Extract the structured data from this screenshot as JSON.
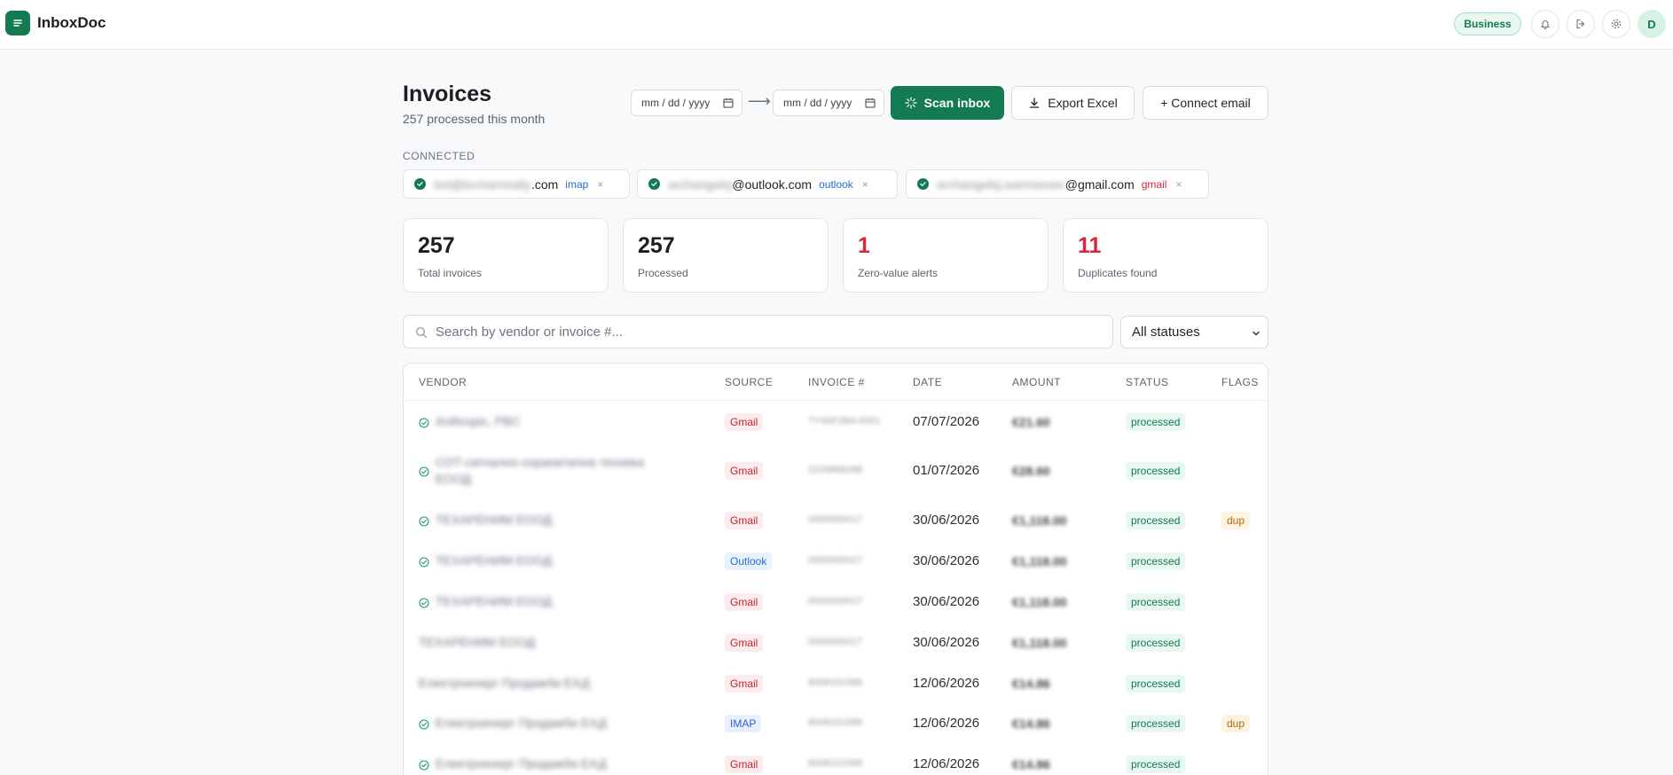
{
  "app": {
    "name": "InboxDoc",
    "plan": "Business",
    "avatar_initial": "D",
    "accent_color": "#137a52"
  },
  "header": {
    "title": "Invoices",
    "subtitle": "257 processed this month",
    "date_from_placeholder": "mm / dd / yyyy",
    "date_to_placeholder": "mm / dd / yyyy",
    "arrow": "⟶",
    "scan_label": "Scan inbox",
    "export_label": "Export Excel",
    "connect_label": "+ Connect email"
  },
  "connected": {
    "label": "CONNECTED",
    "accounts": [
      {
        "hidden": "bot@bcmanrealty",
        "visible": ".com",
        "provider": "imap",
        "provider_color": "#1f6fd0"
      },
      {
        "hidden": "archangeliq",
        "visible": "@outlook.com",
        "provider": "outlook",
        "provider_color": "#1f6fd0"
      },
      {
        "hidden": "archangeliq.warmasser",
        "visible": "@gmail.com",
        "provider": "gmail",
        "provider_color": "#d7263d"
      }
    ],
    "remove_glyph": "×"
  },
  "stats": [
    {
      "value": "257",
      "label": "Total invoices",
      "alert": false
    },
    {
      "value": "257",
      "label": "Processed",
      "alert": false
    },
    {
      "value": "1",
      "label": "Zero-value alerts",
      "alert": true
    },
    {
      "value": "11",
      "label": "Duplicates found",
      "alert": true
    }
  ],
  "filters": {
    "search_placeholder": "Search by vendor or invoice #...",
    "status_selected": "All statuses"
  },
  "table": {
    "columns": [
      "VENDOR",
      "SOURCE",
      "INVOICE #",
      "DATE",
      "AMOUNT",
      "STATUS",
      "FLAGS"
    ],
    "rows": [
      {
        "vendor": "Anthropic, PBC",
        "verified": true,
        "source": "Gmail",
        "invoice": "7Y4AF2B4-0001",
        "date": "07/07/2026",
        "amount": "€21.60",
        "status": "processed",
        "flag": ""
      },
      {
        "vendor": "СОТ-сигнално-охранителна техника ЕООД",
        "verified": true,
        "source": "Gmail",
        "invoice": "2226866288",
        "date": "01/07/2026",
        "amount": "€28.60",
        "status": "processed",
        "flag": ""
      },
      {
        "vendor": "ТЕХАРЕНИМ ЕООД",
        "verified": true,
        "source": "Gmail",
        "invoice": "0000000017",
        "date": "30/06/2026",
        "amount": "€1,118.00",
        "status": "processed",
        "flag": "dup"
      },
      {
        "vendor": "ТЕХАРЕНИМ ЕООД",
        "verified": true,
        "source": "Outlook",
        "invoice": "0000000017",
        "date": "30/06/2026",
        "amount": "€1,118.00",
        "status": "processed",
        "flag": ""
      },
      {
        "vendor": "ТЕХАРЕНИМ ЕООД",
        "verified": true,
        "source": "Gmail",
        "invoice": "0000000017",
        "date": "30/06/2026",
        "amount": "€1,118.00",
        "status": "processed",
        "flag": ""
      },
      {
        "vendor": "ТЕХАРЕНИМ ЕООД",
        "verified": false,
        "source": "Gmail",
        "invoice": "0000000017",
        "date": "30/06/2026",
        "amount": "€1,118.00",
        "status": "processed",
        "flag": ""
      },
      {
        "vendor": "Електроенерг Продажби ЕАД",
        "verified": false,
        "source": "Gmail",
        "invoice": "8008151589",
        "date": "12/06/2026",
        "amount": "€14.86",
        "status": "processed",
        "flag": ""
      },
      {
        "vendor": "Електроенерг Продажби ЕАД",
        "verified": true,
        "source": "IMAP",
        "invoice": "8008151589",
        "date": "12/06/2026",
        "amount": "€14.86",
        "status": "processed",
        "flag": "dup"
      },
      {
        "vendor": "Електроенерг Продажби ЕАД",
        "verified": true,
        "source": "Gmail",
        "invoice": "8008151589",
        "date": "12/06/2026",
        "amount": "€14.86",
        "status": "processed",
        "flag": ""
      }
    ]
  }
}
